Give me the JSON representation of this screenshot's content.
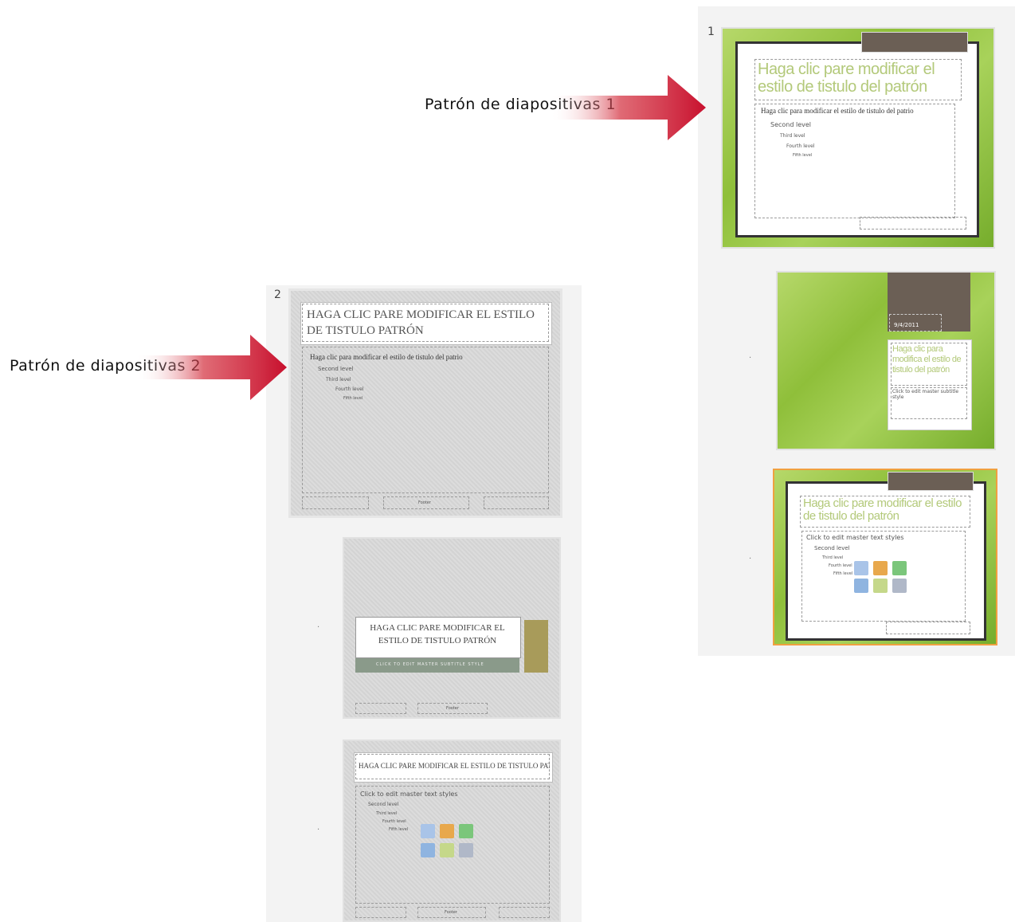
{
  "annotations": {
    "master1": "Patrón de diapositivas 1",
    "master2": "Patrón de diapositivas 2"
  },
  "colors": {
    "arrow": "#c8102e",
    "green": "#8fbf3a",
    "title_green": "#b3c97a",
    "brown": "#6b5f55",
    "olive": "#a89b5a"
  },
  "master1": {
    "number": "1",
    "title": "Haga clic pare modificar el estilo de tistulo del patrón",
    "levels": [
      "Haga clic para modificar el estilo de tistulo del patrio",
      "Second level",
      "Third level",
      "Fourth level",
      "Fifth level"
    ]
  },
  "master1_layout1": {
    "date": "9/4/2011",
    "title": "Haga clic para modifica el estilo de tistulo del patrón",
    "subtitle": "Click to edit master subtitle style"
  },
  "master1_layout2": {
    "title": "Haga clic pare modificar el estilo de tistulo del patrón",
    "levels": [
      "Click to edit master text styles",
      "Second level",
      "Third level",
      "Fourth level",
      "Fifth level"
    ]
  },
  "master2": {
    "number": "2",
    "title": "HAGA CLIC PARE MODIFICAR EL ESTILO DE TISTULO PATRÓN",
    "levels": [
      "Haga clic para modificar el estilo de tistulo del patrio",
      "Second level",
      "Third level",
      "Fourth level",
      "Fifth level"
    ],
    "footer_center": "Footer"
  },
  "master2_layout1": {
    "title": "HAGA CLIC PARE MODIFICAR EL ESTILO DE TISTULO PATRÓN",
    "subtitle": "CLICK TO EDIT MASTER SUBTITLE STYLE",
    "footer_center": "Footer"
  },
  "master2_layout2": {
    "title": "HAGA CLIC PARE MODIFICAR EL ESTILO DE TISTULO PATRÓNE",
    "levels": [
      "Click to edit master text styles",
      "Second level",
      "Third level",
      "Fourth level",
      "Fifth level"
    ],
    "footer_center": "Footer"
  }
}
